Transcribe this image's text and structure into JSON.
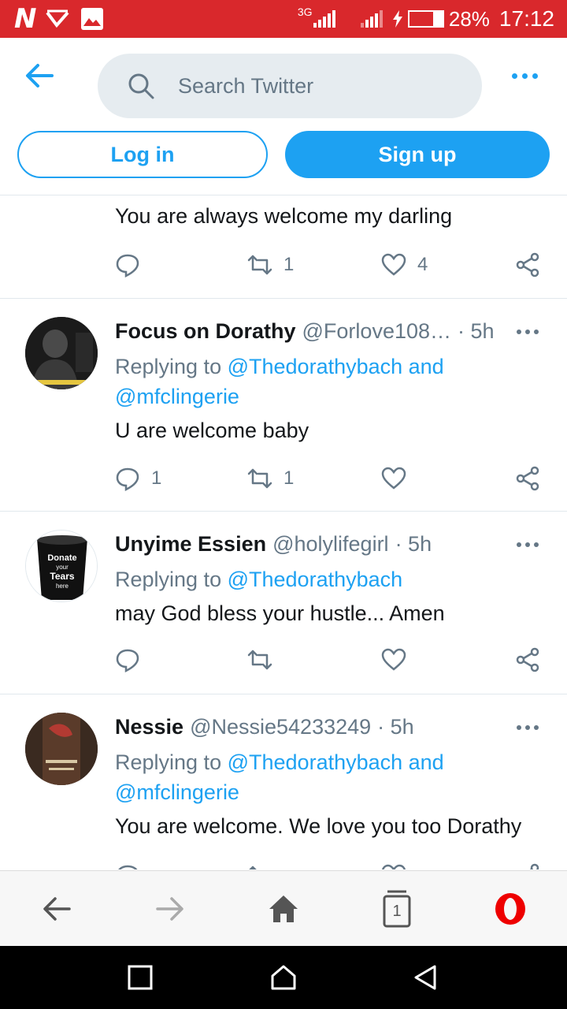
{
  "status_bar": {
    "network_label": "3G",
    "battery": "28%",
    "time": "17:12",
    "colors": {
      "background": "#d9282c"
    }
  },
  "header": {
    "search_placeholder": "Search Twitter",
    "login_label": "Log in",
    "signup_label": "Sign up",
    "colors": {
      "accent": "#1da1f2"
    }
  },
  "partial_tweet": {
    "text": "You are always welcome my darling",
    "retweets": "1",
    "likes": "4"
  },
  "tweets": [
    {
      "name": "Focus on Dorathy",
      "handle": "@Forlove108…",
      "time": "· 5h",
      "reply_prefix": "Replying to",
      "reply_to": "@Thedorathybach and",
      "reply_to_2": "@mfclingerie",
      "text": "U are welcome baby",
      "replies": "1",
      "retweets": "1",
      "likes": ""
    },
    {
      "name": "Unyime Essien",
      "handle": "@holylifegirl",
      "time": "· 5h",
      "reply_prefix": "Replying to",
      "reply_to": "@Thedorathybach",
      "text": "may God bless your hustle... Amen",
      "replies": "",
      "retweets": "",
      "likes": "",
      "avatar_text": [
        "Donate",
        "your",
        "Tears",
        "here"
      ]
    },
    {
      "name": "Nessie",
      "handle": "@Nessie54233249",
      "time": "· 5h",
      "reply_prefix": "Replying to",
      "reply_to": "@Thedorathybach and",
      "reply_to_2": "@mfclingerie",
      "text": "You are welcome. We love you too Dorathy"
    }
  ],
  "browser_bar": {
    "tab_count": "1",
    "icons": [
      "back-arrow-icon",
      "forward-arrow-icon",
      "home-icon",
      "tabs-icon",
      "opera-menu-icon"
    ]
  },
  "android_nav": {
    "icons": [
      "recents-square-icon",
      "home-circle-icon",
      "back-triangle-icon"
    ]
  }
}
